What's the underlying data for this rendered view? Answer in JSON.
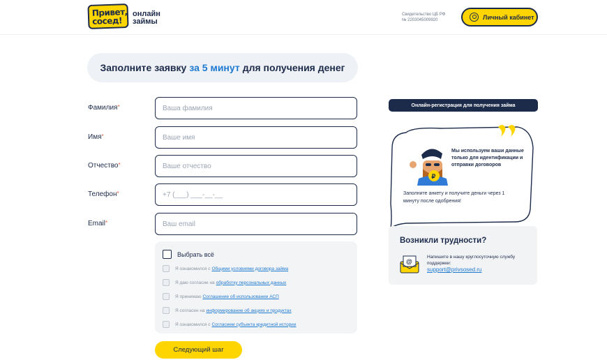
{
  "header": {
    "logo_text": "Привет, сосед!",
    "brand_sub_1": "онлайн",
    "brand_sub_2": "займы",
    "license_1": "Свидетельство ЦБ РФ",
    "license_2": "№ 2203045009920",
    "cabinet_label": "Личный кабинет"
  },
  "title": {
    "part1": "Заполните заявку",
    "accent": "за 5 минут",
    "part2": "для получения денег"
  },
  "form": {
    "fields": [
      {
        "label": "Фамилия",
        "placeholder": "Ваша фамилия"
      },
      {
        "label": "Имя",
        "placeholder": "Ваше имя"
      },
      {
        "label": "Отчество",
        "placeholder": "Ваше отчество"
      },
      {
        "label": "Телефон",
        "placeholder": "+7 (___) ___-__-__"
      },
      {
        "label": "Email",
        "placeholder": "Ваш email"
      }
    ],
    "required_mark": "*"
  },
  "consents": {
    "select_all": "Выбрать всё",
    "items": [
      {
        "prefix": "Я ознакомился с",
        "link": "Общими условиями договора займа"
      },
      {
        "prefix": "Я даю согласие на",
        "link": "обработку персональных данных"
      },
      {
        "prefix": "Я принимаю",
        "link": "Соглашение об использовании АСП"
      },
      {
        "prefix": "Я согласен на",
        "link": "информирование об акциях и продуктах"
      },
      {
        "prefix": "Я ознакомился с",
        "link": "Согласием субъекта кредитной истории"
      }
    ]
  },
  "next_button": "Следующий шаг",
  "sidebar": {
    "badge": "Онлайн-регистрация для получения займа",
    "bubble_text": "Мы используем ваши данные только для идентификации и отправки договоров",
    "bubble_note": "Заполните анкету и получите деньги через 1 минуту после одобрения!",
    "help_title": "Возникли трудности?",
    "help_text": "Напишите в нашу круглосуточную службу поддержки:",
    "help_email": "support@privsosed.ru"
  },
  "colors": {
    "accent_yellow": "#ffd500",
    "navy": "#1d2b4a",
    "link_blue": "#1f7ad1"
  }
}
